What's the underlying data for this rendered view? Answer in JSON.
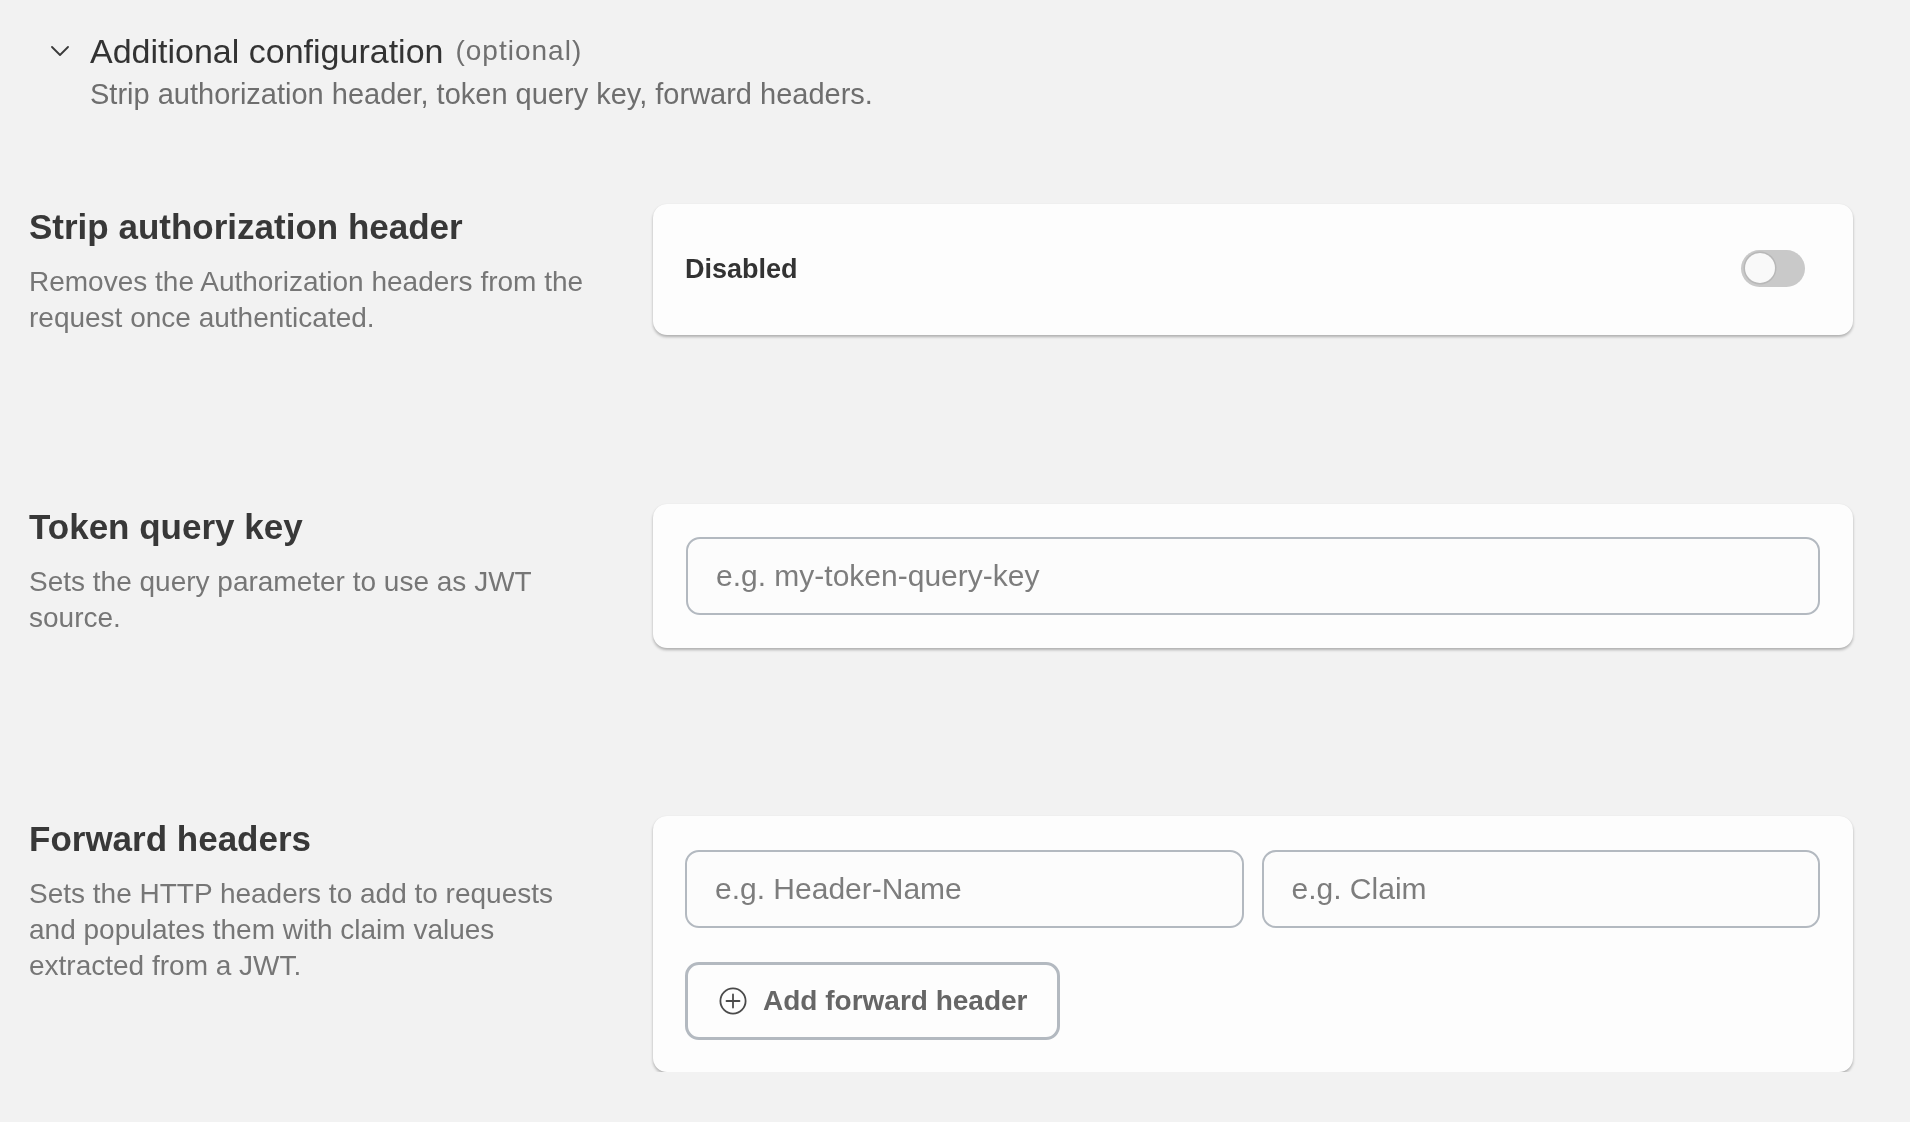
{
  "section": {
    "title": "Additional configuration",
    "optional_label": "(optional)",
    "expanded": true,
    "subtitle": "Strip authorization header, token query key, forward headers."
  },
  "settings": [
    {
      "kind": "toggle",
      "title": "Strip authorization header",
      "description": "Removes the Authorization headers from the request once authenticated.",
      "toggle": {
        "label": "Disabled",
        "on": false
      }
    },
    {
      "kind": "text",
      "title": "Token query key",
      "description": "Sets the query parameter to use as JWT source.",
      "field": {
        "placeholder": "e.g. my-token-query-key"
      }
    },
    {
      "kind": "pairs",
      "title": "Forward headers",
      "description": "Sets the HTTP headers to add to requests and populates them with claim values extracted from a JWT.",
      "fields": [
        {
          "placeholder": "e.g. Header-Name"
        },
        {
          "placeholder": "e.g. Claim"
        }
      ],
      "button": "Add forward header"
    }
  ]
}
